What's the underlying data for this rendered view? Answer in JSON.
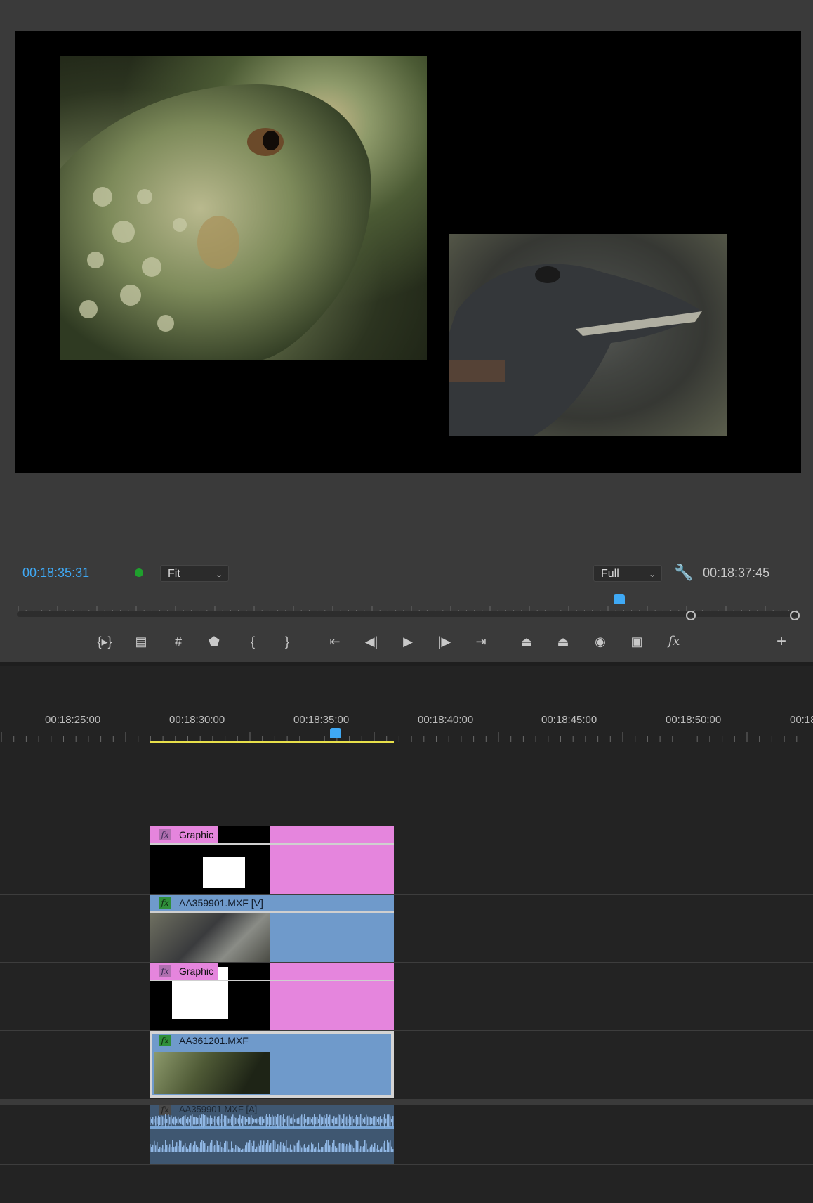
{
  "program_monitor": {
    "current_timecode": "00:18:35:31",
    "duration_timecode": "00:18:37:45",
    "zoom": "Fit",
    "quality": "Full",
    "playhead_fraction": 0.77,
    "controls": [
      {
        "name": "insert-edit-button",
        "glyph": "{▸}"
      },
      {
        "name": "clapper-button",
        "glyph": "▤"
      },
      {
        "name": "safe-margins-button",
        "glyph": "#"
      },
      {
        "name": "add-marker-button",
        "glyph": "⬟"
      },
      {
        "name": "mark-in-button",
        "glyph": "{"
      },
      {
        "name": "mark-out-button",
        "glyph": "}"
      },
      {
        "name": "go-to-in-button",
        "glyph": "⇤"
      },
      {
        "name": "step-back-button",
        "glyph": "◀|"
      },
      {
        "name": "play-button",
        "glyph": "▶"
      },
      {
        "name": "step-forward-button",
        "glyph": "|▶"
      },
      {
        "name": "go-to-out-button",
        "glyph": "⇥"
      },
      {
        "name": "lift-button",
        "glyph": "⏏"
      },
      {
        "name": "extract-button",
        "glyph": "⏏"
      },
      {
        "name": "export-frame-button",
        "glyph": "◉"
      },
      {
        "name": "comparison-view-button",
        "glyph": "▣"
      },
      {
        "name": "fx-button",
        "glyph": "fx"
      },
      {
        "name": "add-button",
        "glyph": "+"
      }
    ]
  },
  "timeline": {
    "ruler_labels": [
      "00:18:25:00",
      "00:18:30:00",
      "00:18:35:00",
      "00:18:40:00",
      "00:18:45:00",
      "00:18:50:00",
      "00:18:"
    ],
    "clips": {
      "v4_label": "Graphic",
      "v3_label": "AA359901.MXF [V]",
      "v2_label": "Graphic",
      "v1_label": "AA361201.MXF",
      "a1_label": "AA359901.MXF [A]",
      "fx_label": "fx"
    }
  },
  "colors": {
    "accent": "#3fa9f5",
    "graphic_clip": "#e585dd",
    "video_clip": "#6f9acb",
    "work_area": "#e8e04a",
    "status_dot": "#1fa02d"
  }
}
